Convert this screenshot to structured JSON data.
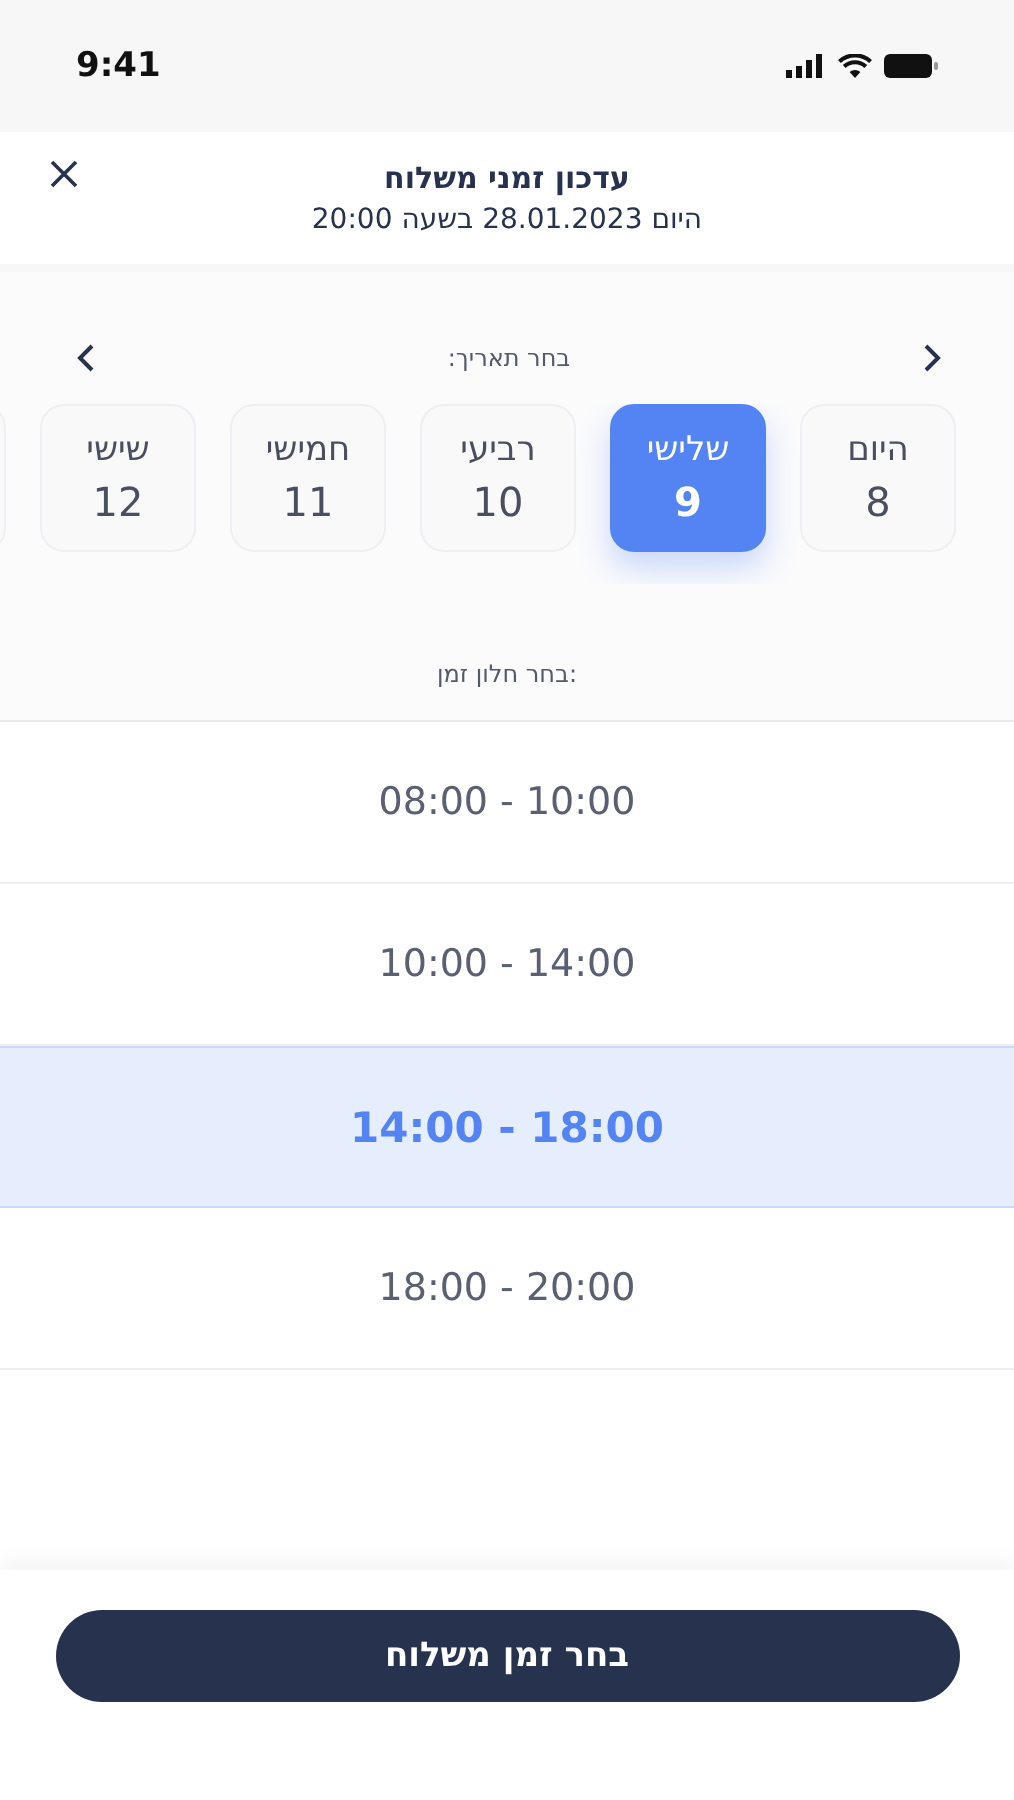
{
  "status_bar": {
    "time": "9:41"
  },
  "header": {
    "title": "עדכון זמני משלוח",
    "subtitle": "היום 28.01.2023 בשעה 20:00"
  },
  "date_picker": {
    "label": "בחר תאריך:",
    "days": [
      {
        "name": "היום",
        "number": "8",
        "selected": false
      },
      {
        "name": "שלישי",
        "number": "9",
        "selected": true
      },
      {
        "name": "רביעי",
        "number": "10",
        "selected": false
      },
      {
        "name": "חמישי",
        "number": "11",
        "selected": false
      },
      {
        "name": "שישי",
        "number": "12",
        "selected": false
      }
    ]
  },
  "time_picker": {
    "label": "בחר חלון זמן:",
    "slots": [
      {
        "label": "08:00 - 10:00",
        "selected": false
      },
      {
        "label": "10:00 - 14:00",
        "selected": false
      },
      {
        "label": "14:00 - 18:00",
        "selected": true
      },
      {
        "label": "18:00 - 20:00",
        "selected": false
      }
    ]
  },
  "button": "בחר זמן משלוח"
}
